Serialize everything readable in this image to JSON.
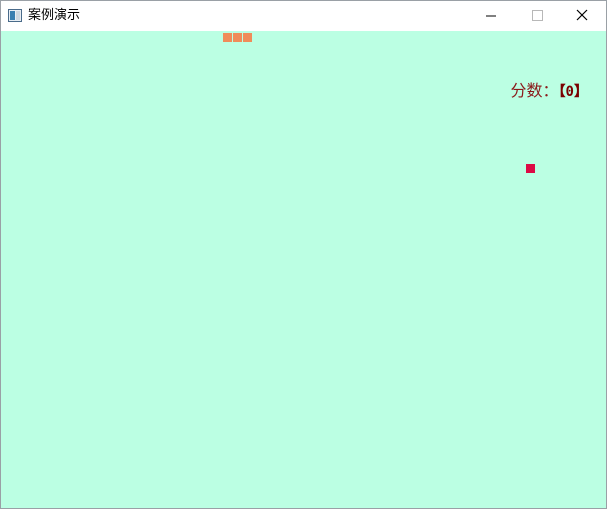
{
  "window": {
    "title": "案例演示",
    "icon": "app-window-icon",
    "controls": {
      "minimize_icon": "minimize-icon",
      "maximize_icon": "maximize-icon",
      "close_icon": "close-icon"
    }
  },
  "game": {
    "background_color": "#bbffe3",
    "snake_color": "#f08c5a",
    "food_color": "#dc0a45",
    "score_label": "分数：",
    "score_value": "【0】"
  }
}
